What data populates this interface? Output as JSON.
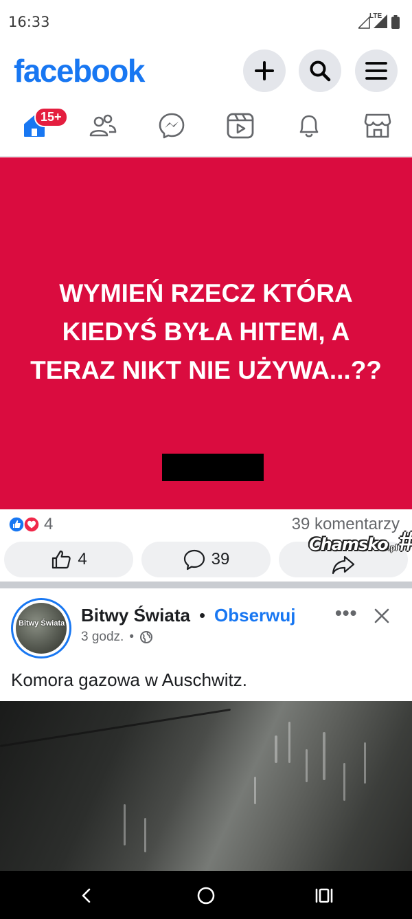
{
  "status_bar": {
    "time": "16:33",
    "network_label": "LTE",
    "icons": [
      "signal-icon",
      "battery-icon"
    ]
  },
  "header": {
    "logo": "facebook",
    "buttons": [
      "plus-icon",
      "search-icon",
      "menu-icon"
    ]
  },
  "nav": {
    "items": [
      "home-icon",
      "friends-icon",
      "messenger-icon",
      "video-icon",
      "notifications-icon",
      "marketplace-icon"
    ],
    "home_badge": "15+"
  },
  "post1": {
    "text": "WYMIEŃ RZECZ KTÓRA\nKIEDYŚ BYŁA HITEM, A\nTERAZ NIKT NIE UŻYWA...??",
    "background_color": "#da0c3f",
    "reaction_count": "4",
    "comments_label": "39 komentarzy",
    "actions": {
      "like_count": "4",
      "comment_count": "39"
    }
  },
  "watermark": {
    "text": "Chamsko",
    "tld": ".pl",
    "symbol": "#"
  },
  "post2": {
    "page_name": "Bitwy Świata",
    "separator": "•",
    "follow_label": "Obserwuj",
    "time": "3 godz.",
    "time_separator": "•",
    "avatar_text": "Bitwy Świata",
    "more_label": "•••",
    "text": "Komora gazowa w Auschwitz."
  },
  "system_nav": [
    "back-icon",
    "home-circle-icon",
    "recents-icon"
  ],
  "colors": {
    "brand": "#1877f2",
    "badge": "#e41e3f",
    "secondary_text": "#65676b"
  }
}
